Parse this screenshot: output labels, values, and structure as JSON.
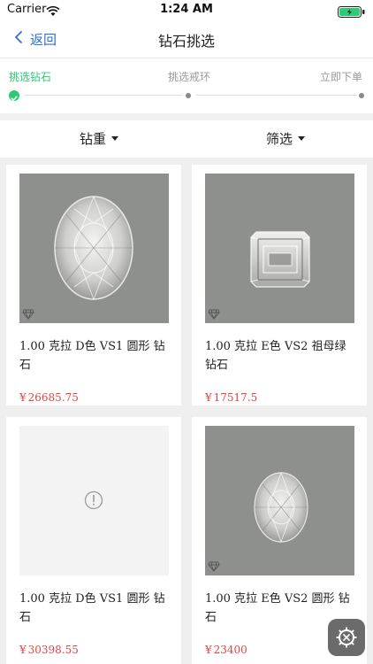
{
  "status_bar": {
    "carrier": "Carrier",
    "time": "1:24 AM",
    "battery_level": 1.0
  },
  "nav": {
    "back_label": "返回",
    "title": "钻石挑选"
  },
  "steps": [
    {
      "label": "挑选钻石",
      "active": true
    },
    {
      "label": "挑选戒环",
      "active": false
    },
    {
      "label": "立即下单",
      "active": false
    }
  ],
  "filters": {
    "weight_label": "钻重",
    "filter_label": "筛选"
  },
  "products": [
    {
      "name": "1.00 克拉 D色 VS1 圆形 钻石",
      "currency": "¥",
      "price": "26685.75",
      "shape": "oval"
    },
    {
      "name": "1.00 克拉 E色 VS2 祖母绿钻石",
      "currency": "¥",
      "price": "17517.5",
      "shape": "emerald"
    },
    {
      "name": "1.00 克拉 D色 VS1 圆形 钻石",
      "currency": "¥",
      "price": "30398.55",
      "shape": "placeholder"
    },
    {
      "name": "1.00 克拉 E色 VS2 圆形 钻石",
      "currency": "¥",
      "price": "23400",
      "shape": "oval"
    }
  ],
  "colors": {
    "accent_green": "#2ecb75",
    "link_blue": "#2f6ed6",
    "price_red": "#e04545"
  },
  "icons": {
    "back": "chevron-left-icon",
    "done": "check-circle-icon",
    "settings": "gear-icon",
    "error": "alert-circle-icon"
  }
}
